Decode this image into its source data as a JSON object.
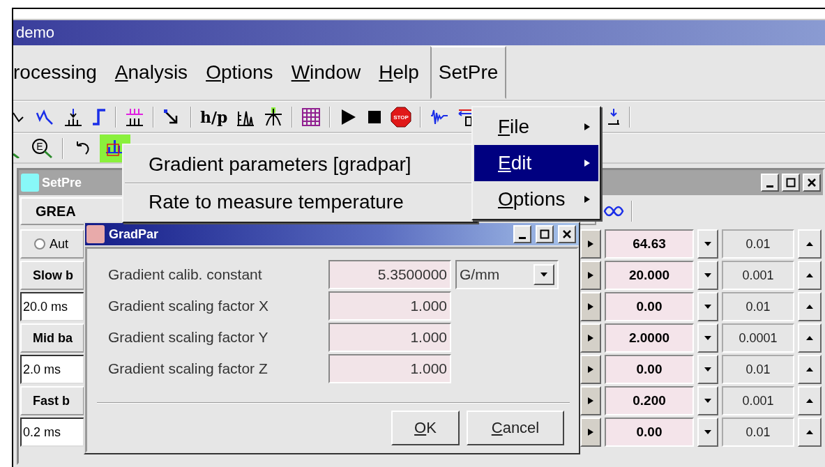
{
  "window": {
    "title": "demo"
  },
  "menu_bar": [
    {
      "label": "rocessing",
      "mnemonic": false,
      "selected": false
    },
    {
      "label": "Analysis",
      "mnemonic": true,
      "selected": false
    },
    {
      "label": "Options",
      "mnemonic": true,
      "selected": false
    },
    {
      "label": "Window",
      "mnemonic": true,
      "selected": false
    },
    {
      "label": "Help",
      "mnemonic": true,
      "selected": false
    },
    {
      "label": "SetPre",
      "mnemonic": false,
      "selected": true
    }
  ],
  "toolbar_1": {
    "ratio_label": "h/p",
    "stop_label": "STOP"
  },
  "toolbar_2": {
    "zoom_label": "E",
    "chart_tool_selected": true
  },
  "setpre_window": {
    "title": "SetPre",
    "header": "GREA",
    "rows": [
      {
        "left": {
          "kind": "radio",
          "label": "Aut",
          "checked": false
        },
        "value": "64.63",
        "step": "0.01"
      },
      {
        "left": {
          "kind": "button",
          "label": "Slow b"
        },
        "value": "20.000",
        "step": "0.001"
      },
      {
        "left": {
          "kind": "field",
          "value": "20.0 ms"
        },
        "value": "0.00",
        "step": "0.01"
      },
      {
        "left": {
          "kind": "button",
          "label": "Mid ba"
        },
        "value": "2.0000",
        "step": "0.0001"
      },
      {
        "left": {
          "kind": "field",
          "value": "2.0 ms"
        },
        "value": "0.00",
        "step": "0.01"
      },
      {
        "left": {
          "kind": "button",
          "label": "Fast b"
        },
        "value": "0.200",
        "step": "0.001"
      },
      {
        "left": {
          "kind": "field",
          "value": "0.2 ms"
        },
        "value": "0.00",
        "step": "0.01"
      }
    ]
  },
  "setpre_menu": [
    {
      "label": "File",
      "selected": false
    },
    {
      "label": "Edit",
      "selected": true
    },
    {
      "label": "Options",
      "selected": false
    }
  ],
  "edit_submenu": [
    "Gradient parameters [gradpar]",
    "Rate to measure temperature"
  ],
  "gradpar_dialog": {
    "title": "GradPar",
    "fields": [
      {
        "label": "Gradient calib. constant",
        "value": "5.3500000",
        "unit": "G/mm"
      },
      {
        "label": "Gradient scaling factor X",
        "value": "1.000"
      },
      {
        "label": "Gradient scaling factor Y",
        "value": "1.000"
      },
      {
        "label": "Gradient scaling factor Z",
        "value": "1.000"
      }
    ],
    "buttons": [
      "OK",
      "Cancel"
    ]
  }
}
